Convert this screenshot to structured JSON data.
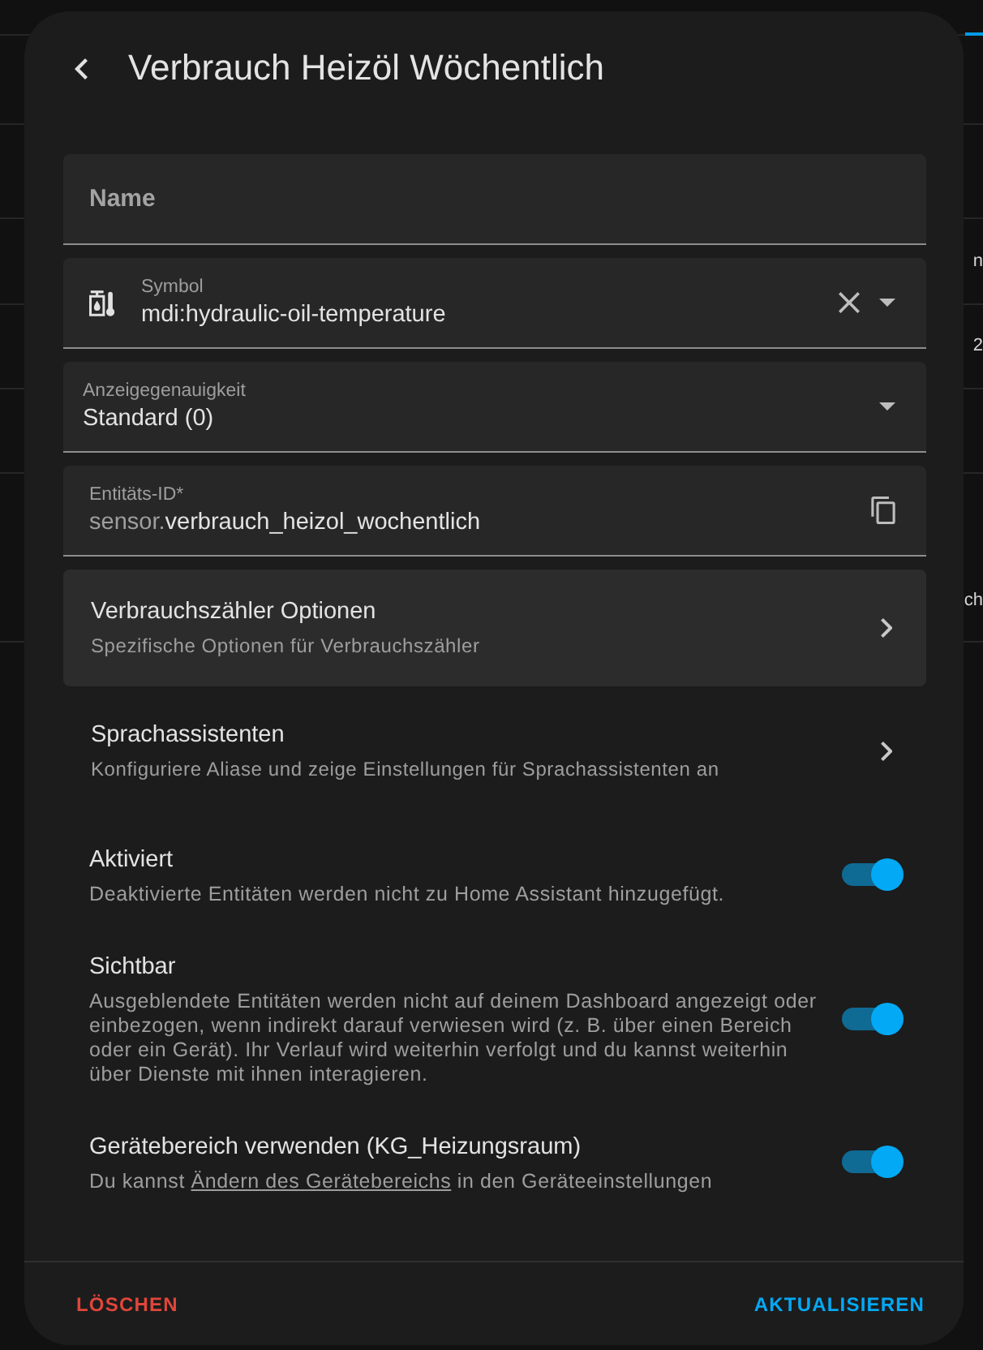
{
  "background": {
    "fragments": [
      "n",
      "2",
      "ch"
    ]
  },
  "dialog": {
    "title": "Verbrauch Heizöl Wöchentlich"
  },
  "fields": [
    {
      "kind": "text",
      "label": "Name"
    },
    {
      "kind": "icon_picker",
      "label": "Symbol",
      "value": "mdi:hydraulic-oil-temperature"
    },
    {
      "kind": "select",
      "label": "Anzeigegenauigkeit",
      "value": "Standard (0)"
    },
    {
      "kind": "entity_id",
      "label": "Entitäts-ID*",
      "prefix": "sensor.",
      "value": "verbrauch_heizol_wochentlich"
    }
  ],
  "menu_items": [
    {
      "kind": "card",
      "title": "Verbrauchszähler Optionen",
      "subtitle": "Spezifische Optionen für Verbrauchszähler"
    },
    {
      "kind": "plain",
      "title": "Sprachassistenten",
      "subtitle": "Konfiguriere Aliase und zeige Einstellungen für Sprachassistenten an"
    }
  ],
  "switches": [
    {
      "title": "Aktiviert",
      "description": "Deaktivierte Entitäten werden nicht zu Home Assistant hinzugefügt.",
      "on": true
    },
    {
      "title": "Sichtbar",
      "description": "Ausgeblendete Entitäten werden nicht auf deinem Dashboard angezeigt oder einbezogen, wenn indirekt darauf verwiesen wird (z. B. über einen Bereich oder ein Gerät). Ihr Verlauf wird weiterhin verfolgt und du kannst weiterhin über Dienste mit ihnen interagieren.",
      "on": true
    },
    {
      "title": "Gerätebereich verwenden (KG_Heizungsraum)",
      "description": "Du kannst",
      "link": "Ändern des Gerätebereichs",
      "description_end": "in den Geräteeinstellungen",
      "on": true
    }
  ],
  "footer": {
    "buttons": [
      {
        "kind": "danger",
        "label": "LÖSCHEN"
      },
      {
        "kind": "primary",
        "label": "AKTUALISIEREN"
      }
    ]
  }
}
